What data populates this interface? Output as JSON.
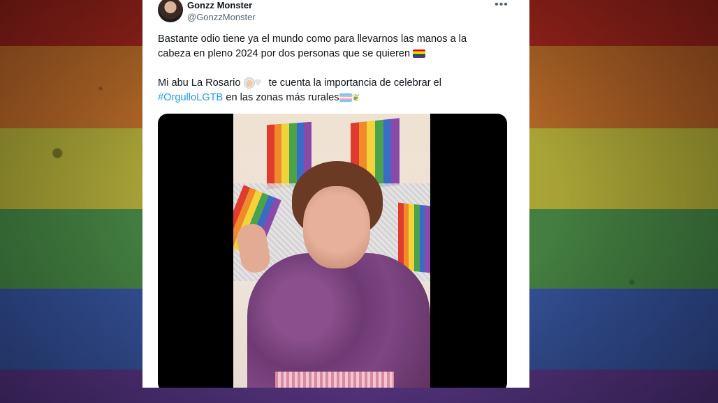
{
  "tweet": {
    "author_name": "Gonzz Monster",
    "author_handle": "@GonzzMonster",
    "more_label": "•••",
    "line1": "Bastante odio tiene ya el mundo como para llevarnos las manos a la",
    "line2": "cabeza en pleno 2024 por dos personas que se quieren",
    "line3_a": "Mi abu La Rosario",
    "line3_b": "te cuenta la importancia de celebrar el",
    "hashtag": "#OrgulloLGTB",
    "line4_b": "en las zonas más rurales",
    "emoji_rainbow_flag": "rainbow-flag-icon",
    "emoji_grandma": "older-woman-icon",
    "emoji_heart": "white-heart-icon",
    "emoji_trans_flag": "transgender-flag-icon",
    "emoji_wheat": "sheaf-of-rice-icon"
  },
  "colors": {
    "hashtag": "#1d9bf0",
    "text": "#0f1419",
    "secondary": "#536471"
  }
}
